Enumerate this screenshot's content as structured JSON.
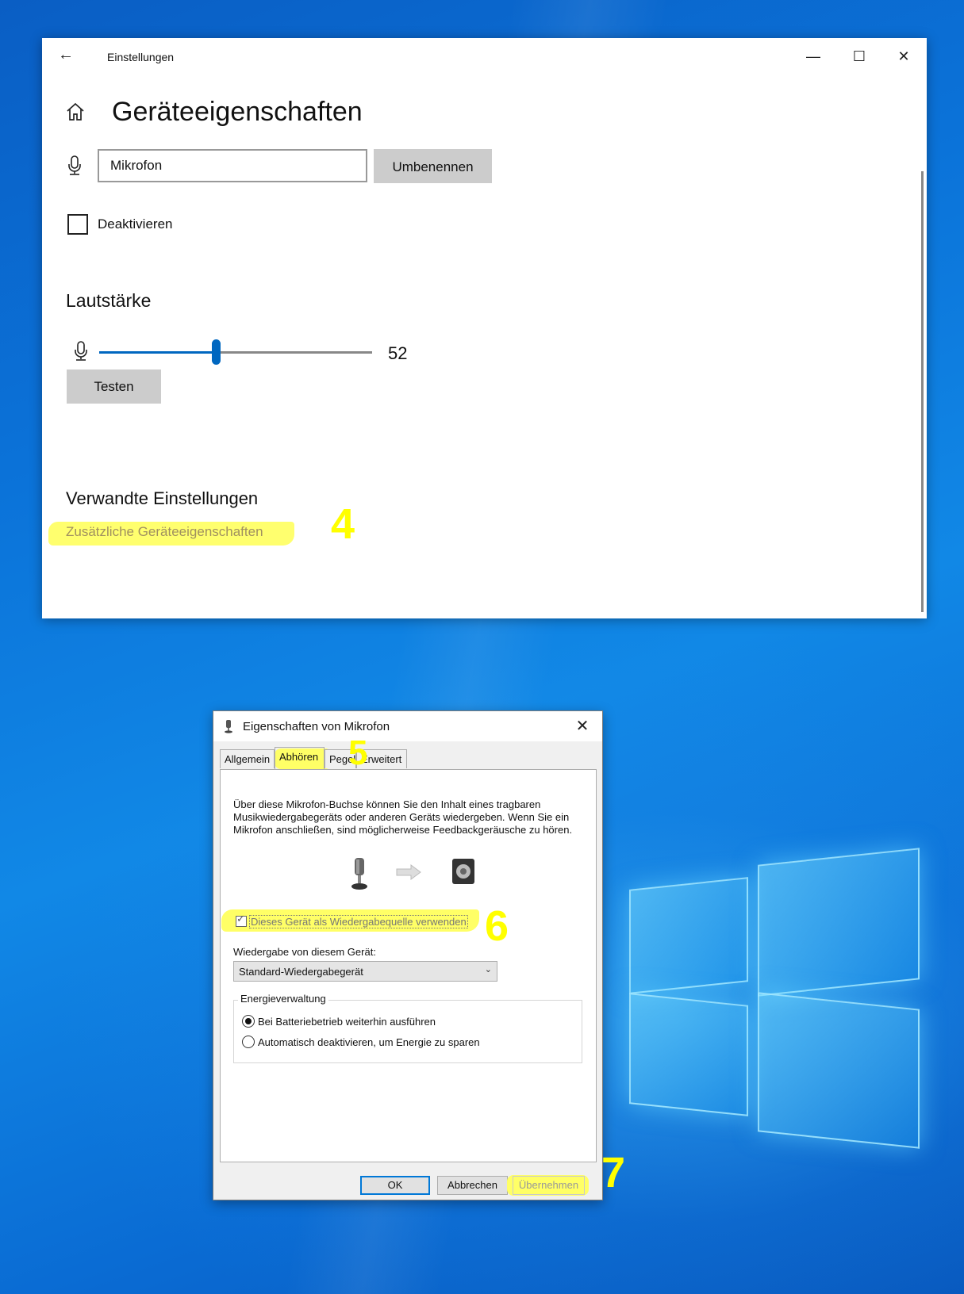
{
  "settings": {
    "app_title": "Einstellungen",
    "page_title": "Geräteeigenschaften",
    "device_name": "Mikrofon",
    "rename_label": "Umbenennen",
    "disable_label": "Deaktivieren",
    "volume_heading": "Lautstärke",
    "volume_value": "52",
    "volume_level": 0.52,
    "test_label": "Testen",
    "related_heading": "Verwandte Einstellungen",
    "additional_link": "Zusätzliche Geräteeigenschaften",
    "step": "4"
  },
  "dialog": {
    "title": "Eigenschaften von Mikrofon",
    "close_glyph": "✕",
    "tabs": [
      "Allgemein",
      "Abhören",
      "Pegel",
      "Erweitert"
    ],
    "active_tab": "Abhören",
    "step_tab": "5",
    "description": "Über diese Mikrofon-Buchse können Sie den Inhalt eines tragbaren Musikwiedergabegeräts oder anderen Geräts wiedergeben. Wenn Sie ein Mikrofon anschließen, sind möglicherweise Feedbackgeräusche zu hören.",
    "listen_checkbox_label": "Dieses Gerät als Wiedergabequelle verwenden",
    "listen_checked": true,
    "step_checkbox": "6",
    "playback_label": "Wiedergabe von diesem Gerät:",
    "playback_value": "Standard-Wiedergabegerät",
    "power_group": "Energieverwaltung",
    "radio_1": "Bei Batteriebetrieb weiterhin ausführen",
    "radio_2": "Automatisch deaktivieren, um Energie zu sparen",
    "ok_label": "OK",
    "cancel_label": "Abbrechen",
    "apply_label": "Übernehmen",
    "step_apply": "7"
  },
  "colors": {
    "accent": "#0067c0",
    "highlight": "#ffff66",
    "step_number": "#ffff00"
  }
}
